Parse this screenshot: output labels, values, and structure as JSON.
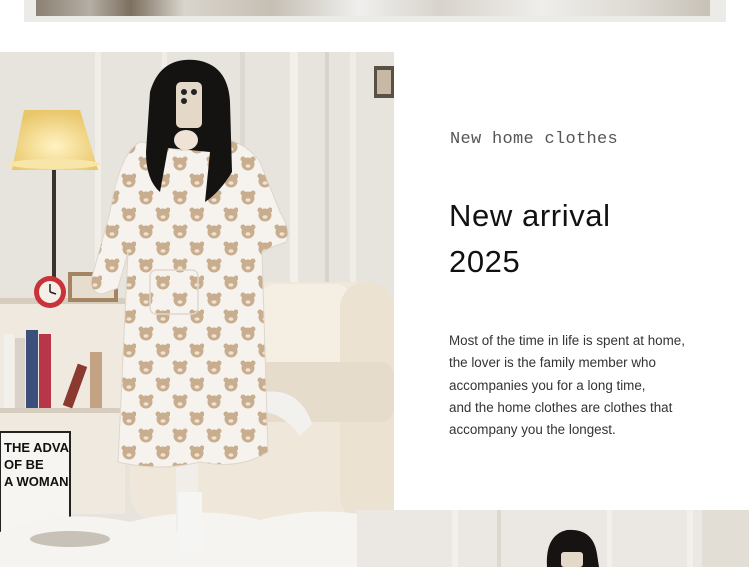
{
  "content": {
    "subtitle": "New home clothes",
    "headline": [
      "New arrival",
      "2025"
    ],
    "body": [
      "Most of the time in life is spent at home,",
      "the lover is the family member who",
      "accompanies you for a long time,",
      "and the home clothes are clothes that",
      "accompany you the longest."
    ]
  },
  "photo": {
    "poster_text": [
      "THE ADVA",
      "OF BE",
      "A WOMAN"
    ],
    "colors": {
      "wall": "#e9e6e1",
      "sofa": "#efe7d9",
      "robe": "#f6f3ee",
      "bear": "#c9ad8f",
      "lamp_shade": "#f3d98a",
      "clock": "#c8323a"
    }
  }
}
